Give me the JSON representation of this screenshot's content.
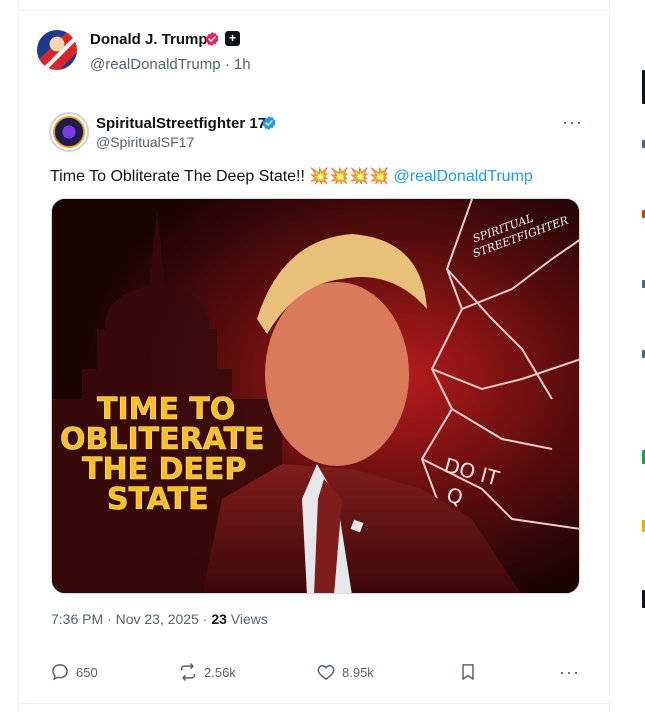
{
  "post": {
    "author_name": "Donald J. Trump",
    "author_handle": "@realDonaldTrump",
    "time_sep": "·",
    "time_ago": "1h",
    "badge_square_glyph": "+"
  },
  "quote": {
    "author_name": "SpiritualStreetfighter 17",
    "author_handle": "@SpiritualSF17",
    "text": "Time To Obliterate The Deep State!!",
    "emojis": "💥💥💥💥",
    "mention": "@realDonaldTrump",
    "image_overlay_text_1": "TIME TO",
    "image_overlay_text_2": "OBLITERATE",
    "image_overlay_text_3": "THE DEEP",
    "image_overlay_text_4": "STATE",
    "image_watermark_1": "SPIRITUAL",
    "image_watermark_2": "STREETFIGHTER",
    "image_lapel_1": "DO IT",
    "image_lapel_2": "Q",
    "timestamp": "7:36 PM · Nov 23, 2025 · ",
    "views_count": "23",
    "views_label": " Views",
    "more_label": "···"
  },
  "actions": {
    "replies": "650",
    "reposts": "2.56k",
    "likes": "8.95k",
    "more_label": "···"
  },
  "colors": {
    "accent_blue": "#1d9bf0",
    "muted_text": "#536471",
    "badge_pink": "#e0245e"
  },
  "icons": {
    "reply": "reply-icon",
    "repost": "repost-icon",
    "like": "heart-icon",
    "bookmark": "bookmark-icon",
    "verified": "verified-badge-icon"
  }
}
